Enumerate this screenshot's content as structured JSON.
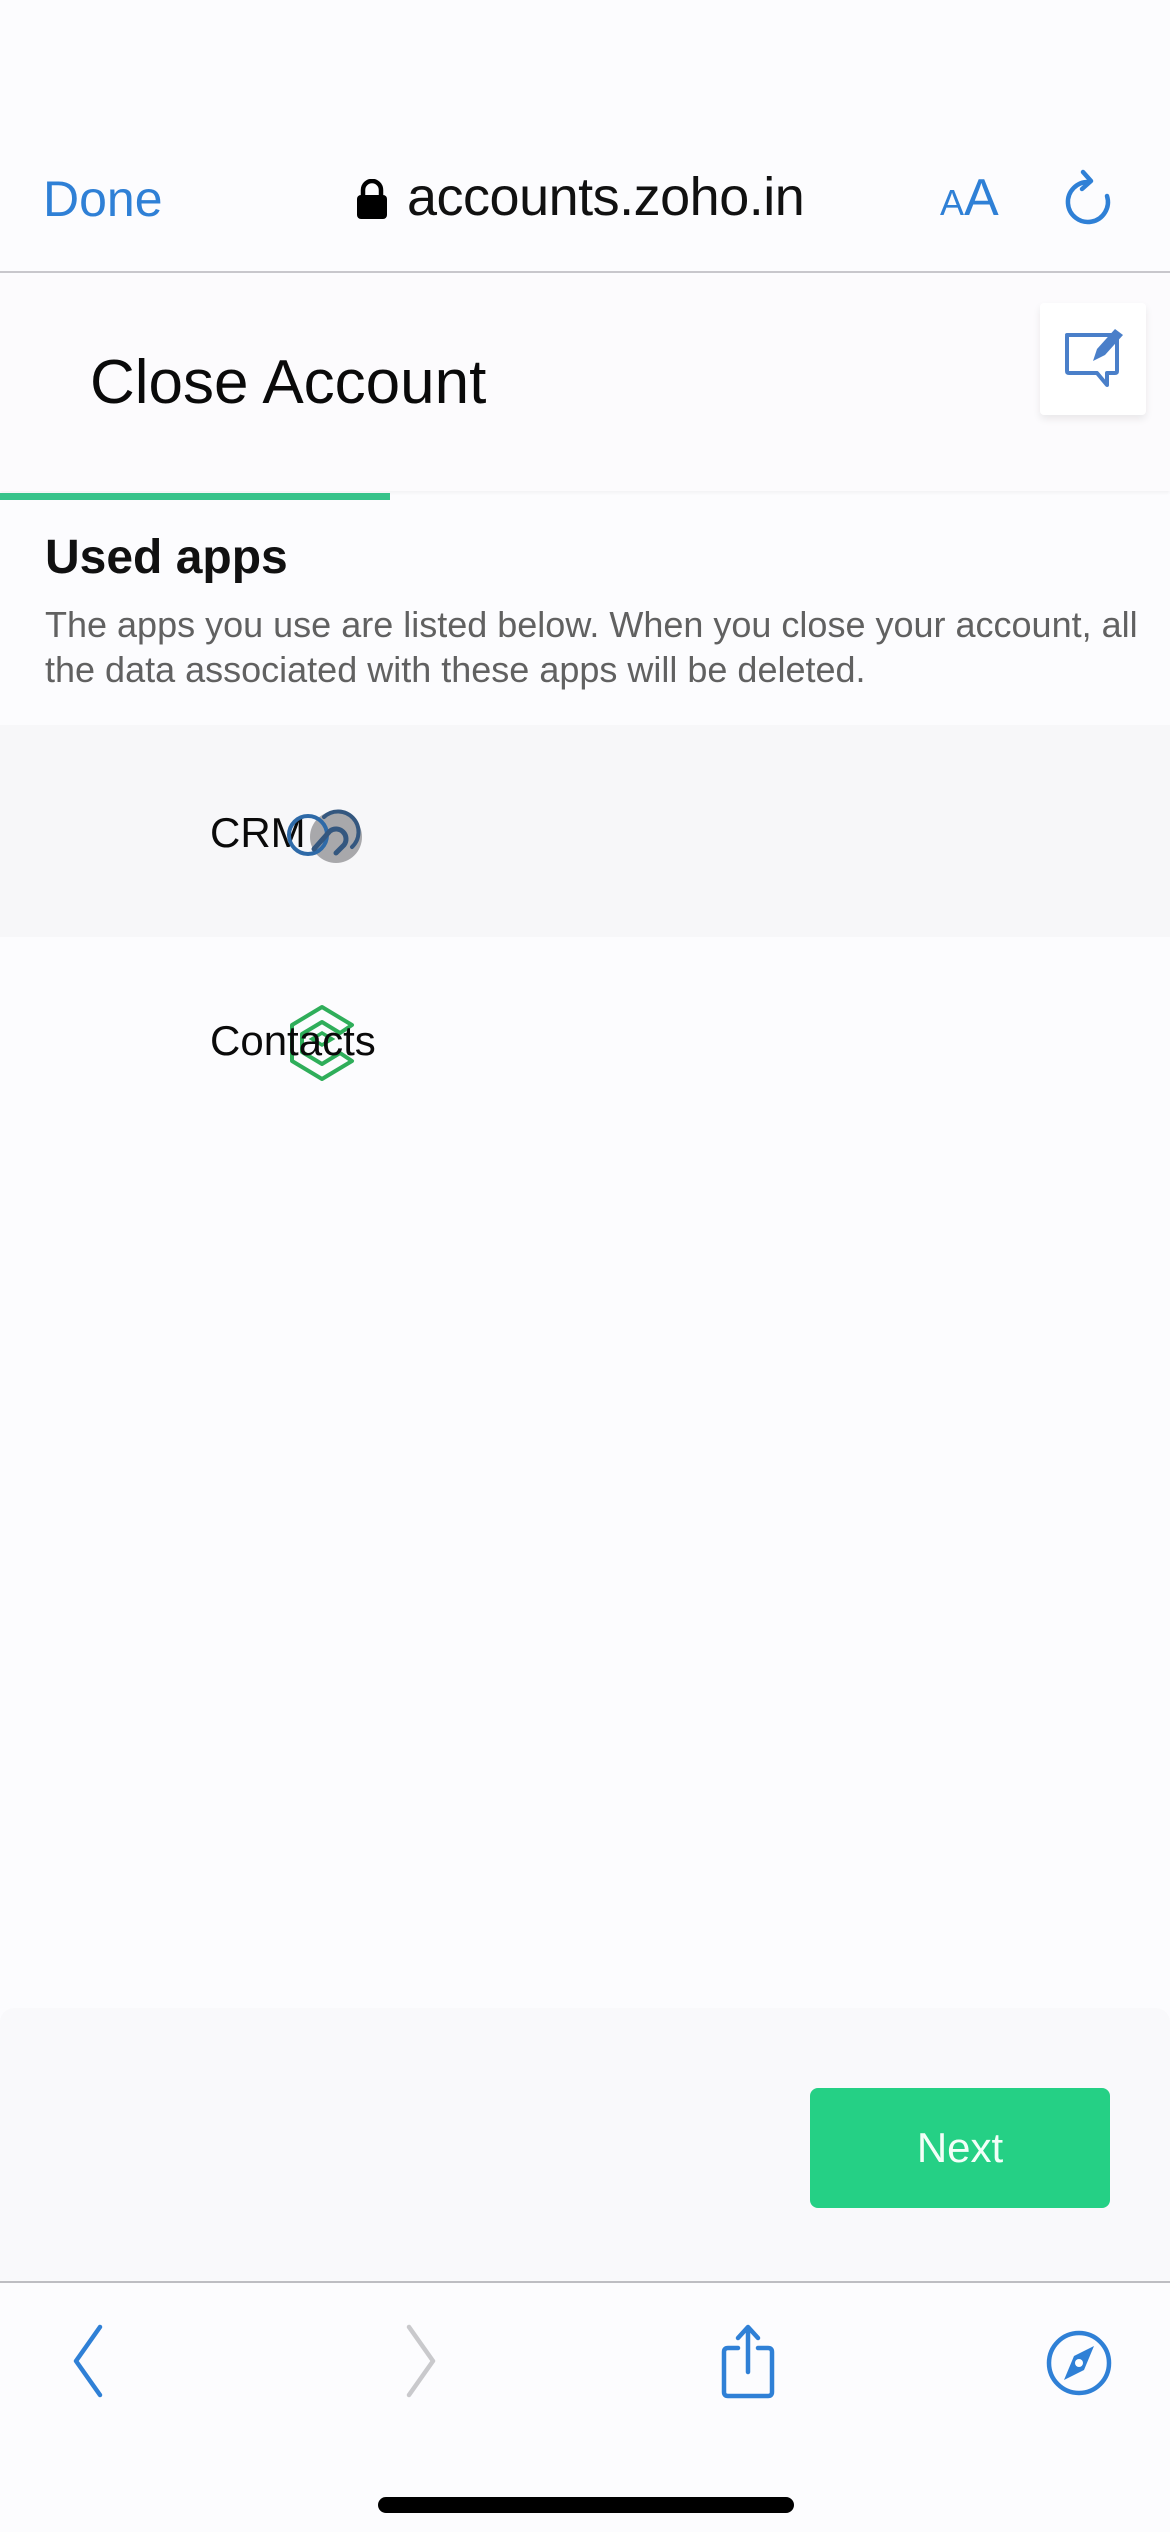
{
  "browser": {
    "done_label": "Done",
    "domain": "accounts.zoho.in",
    "text_size_small": "A",
    "text_size_big": "A",
    "icons": {
      "lock": "lock-icon",
      "reload": "reload-icon",
      "back": "chevron-left-icon",
      "forward": "chevron-right-icon",
      "share": "share-icon",
      "safari": "compass-icon"
    },
    "forward_enabled": false
  },
  "page": {
    "title": "Close Account",
    "feedback_icon": "feedback-edit-icon",
    "progress_fraction": 0.333,
    "section": {
      "title": "Used apps",
      "description": "The apps you use are listed below. When you close your account, all the data associated with these apps will be deleted."
    },
    "apps": [
      {
        "name": "CRM",
        "icon": "zoho-crm-icon"
      },
      {
        "name": "Contacts",
        "icon": "zoho-contacts-icon"
      }
    ],
    "footer": {
      "next_label": "Next"
    }
  },
  "colors": {
    "accent_blue": "#2f80d6",
    "progress_green": "#37c38a",
    "button_green": "#25d085"
  }
}
